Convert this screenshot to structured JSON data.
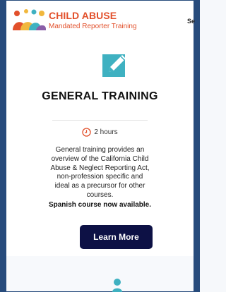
{
  "header": {
    "brand_title": "CHILD ABUSE",
    "brand_subtitle": "Mandated Reporter Training",
    "nav_fragment": "Se"
  },
  "card": {
    "icon": "edit-icon",
    "title": "GENERAL TRAINING",
    "duration": "2 hours",
    "description_lines": [
      "General training provides an",
      "overview of the California Child",
      "Abuse & Neglect Reporting Act,",
      "non-profession specific and",
      "ideal as a precursor for other",
      "courses."
    ],
    "note": "Spanish course now available.",
    "button_label": "Learn More"
  },
  "colors": {
    "accent": "#e2502b",
    "icon_teal": "#3fb1c1",
    "button_bg": "#0d1145",
    "frame": "#274b7c"
  }
}
